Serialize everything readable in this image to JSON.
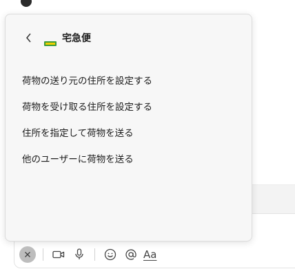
{
  "popup": {
    "title": "宅急便",
    "back_icon": "chevron-left-icon",
    "logo_icon": "yamato-logo-icon",
    "logo_color": "#3a9b3a",
    "items": [
      {
        "label": "荷物の送り元の住所を設定する"
      },
      {
        "label": "荷物を受け取る住所を設定する"
      },
      {
        "label": "住所を指定して荷物を送る"
      },
      {
        "label": "他のユーザーに荷物を送る"
      }
    ]
  },
  "toolbar": {
    "close_icon": "close-icon",
    "video_icon": "video-camera-icon",
    "mic_icon": "microphone-icon",
    "emoji_icon": "smiley-icon",
    "mention_icon": "at-sign-icon",
    "format_label": "Aa"
  }
}
